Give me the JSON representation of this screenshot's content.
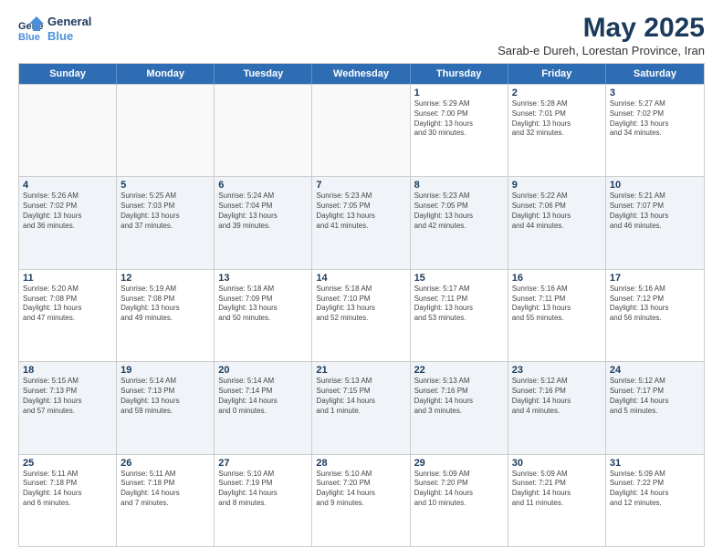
{
  "logo": {
    "line1": "General",
    "line2": "Blue"
  },
  "title": "May 2025",
  "subtitle": "Sarab-e Dureh, Lorestan Province, Iran",
  "days": [
    "Sunday",
    "Monday",
    "Tuesday",
    "Wednesday",
    "Thursday",
    "Friday",
    "Saturday"
  ],
  "weeks": [
    [
      {
        "num": "",
        "info": ""
      },
      {
        "num": "",
        "info": ""
      },
      {
        "num": "",
        "info": ""
      },
      {
        "num": "",
        "info": ""
      },
      {
        "num": "1",
        "info": "Sunrise: 5:29 AM\nSunset: 7:00 PM\nDaylight: 13 hours\nand 30 minutes."
      },
      {
        "num": "2",
        "info": "Sunrise: 5:28 AM\nSunset: 7:01 PM\nDaylight: 13 hours\nand 32 minutes."
      },
      {
        "num": "3",
        "info": "Sunrise: 5:27 AM\nSunset: 7:02 PM\nDaylight: 13 hours\nand 34 minutes."
      }
    ],
    [
      {
        "num": "4",
        "info": "Sunrise: 5:26 AM\nSunset: 7:02 PM\nDaylight: 13 hours\nand 36 minutes."
      },
      {
        "num": "5",
        "info": "Sunrise: 5:25 AM\nSunset: 7:03 PM\nDaylight: 13 hours\nand 37 minutes."
      },
      {
        "num": "6",
        "info": "Sunrise: 5:24 AM\nSunset: 7:04 PM\nDaylight: 13 hours\nand 39 minutes."
      },
      {
        "num": "7",
        "info": "Sunrise: 5:23 AM\nSunset: 7:05 PM\nDaylight: 13 hours\nand 41 minutes."
      },
      {
        "num": "8",
        "info": "Sunrise: 5:23 AM\nSunset: 7:05 PM\nDaylight: 13 hours\nand 42 minutes."
      },
      {
        "num": "9",
        "info": "Sunrise: 5:22 AM\nSunset: 7:06 PM\nDaylight: 13 hours\nand 44 minutes."
      },
      {
        "num": "10",
        "info": "Sunrise: 5:21 AM\nSunset: 7:07 PM\nDaylight: 13 hours\nand 46 minutes."
      }
    ],
    [
      {
        "num": "11",
        "info": "Sunrise: 5:20 AM\nSunset: 7:08 PM\nDaylight: 13 hours\nand 47 minutes."
      },
      {
        "num": "12",
        "info": "Sunrise: 5:19 AM\nSunset: 7:08 PM\nDaylight: 13 hours\nand 49 minutes."
      },
      {
        "num": "13",
        "info": "Sunrise: 5:18 AM\nSunset: 7:09 PM\nDaylight: 13 hours\nand 50 minutes."
      },
      {
        "num": "14",
        "info": "Sunrise: 5:18 AM\nSunset: 7:10 PM\nDaylight: 13 hours\nand 52 minutes."
      },
      {
        "num": "15",
        "info": "Sunrise: 5:17 AM\nSunset: 7:11 PM\nDaylight: 13 hours\nand 53 minutes."
      },
      {
        "num": "16",
        "info": "Sunrise: 5:16 AM\nSunset: 7:11 PM\nDaylight: 13 hours\nand 55 minutes."
      },
      {
        "num": "17",
        "info": "Sunrise: 5:16 AM\nSunset: 7:12 PM\nDaylight: 13 hours\nand 56 minutes."
      }
    ],
    [
      {
        "num": "18",
        "info": "Sunrise: 5:15 AM\nSunset: 7:13 PM\nDaylight: 13 hours\nand 57 minutes."
      },
      {
        "num": "19",
        "info": "Sunrise: 5:14 AM\nSunset: 7:13 PM\nDaylight: 13 hours\nand 59 minutes."
      },
      {
        "num": "20",
        "info": "Sunrise: 5:14 AM\nSunset: 7:14 PM\nDaylight: 14 hours\nand 0 minutes."
      },
      {
        "num": "21",
        "info": "Sunrise: 5:13 AM\nSunset: 7:15 PM\nDaylight: 14 hours\nand 1 minute."
      },
      {
        "num": "22",
        "info": "Sunrise: 5:13 AM\nSunset: 7:16 PM\nDaylight: 14 hours\nand 3 minutes."
      },
      {
        "num": "23",
        "info": "Sunrise: 5:12 AM\nSunset: 7:16 PM\nDaylight: 14 hours\nand 4 minutes."
      },
      {
        "num": "24",
        "info": "Sunrise: 5:12 AM\nSunset: 7:17 PM\nDaylight: 14 hours\nand 5 minutes."
      }
    ],
    [
      {
        "num": "25",
        "info": "Sunrise: 5:11 AM\nSunset: 7:18 PM\nDaylight: 14 hours\nand 6 minutes."
      },
      {
        "num": "26",
        "info": "Sunrise: 5:11 AM\nSunset: 7:18 PM\nDaylight: 14 hours\nand 7 minutes."
      },
      {
        "num": "27",
        "info": "Sunrise: 5:10 AM\nSunset: 7:19 PM\nDaylight: 14 hours\nand 8 minutes."
      },
      {
        "num": "28",
        "info": "Sunrise: 5:10 AM\nSunset: 7:20 PM\nDaylight: 14 hours\nand 9 minutes."
      },
      {
        "num": "29",
        "info": "Sunrise: 5:09 AM\nSunset: 7:20 PM\nDaylight: 14 hours\nand 10 minutes."
      },
      {
        "num": "30",
        "info": "Sunrise: 5:09 AM\nSunset: 7:21 PM\nDaylight: 14 hours\nand 11 minutes."
      },
      {
        "num": "31",
        "info": "Sunrise: 5:09 AM\nSunset: 7:22 PM\nDaylight: 14 hours\nand 12 minutes."
      }
    ]
  ]
}
